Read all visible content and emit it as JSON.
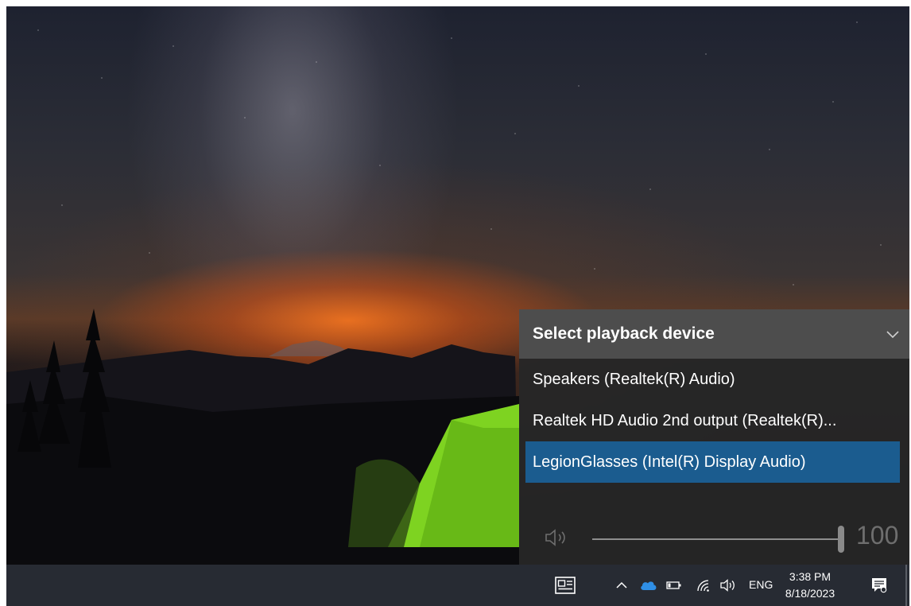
{
  "flyout": {
    "title": "Select playback device",
    "devices": [
      {
        "label": "Speakers (Realtek(R) Audio)",
        "selected": false
      },
      {
        "label": "Realtek HD Audio 2nd output (Realtek(R)...",
        "selected": false
      },
      {
        "label": "LegionGlasses (Intel(R) Display Audio)",
        "selected": true
      }
    ],
    "volume": {
      "value": "100",
      "level_percent": 100
    },
    "colors": {
      "selected_bg": "#1b5c8f",
      "header_bg": "#4d4d4d",
      "panel_bg": "#262626"
    }
  },
  "taskbar": {
    "icons": [
      "news-widget-icon",
      "show-hidden-icons-chevron-icon",
      "onedrive-cloud-icon",
      "battery-icon",
      "wifi-icon",
      "speaker-icon"
    ],
    "language": "ENG",
    "time": "3:38 PM",
    "date": "8/18/2023",
    "notification_icon": "action-center-icon"
  }
}
